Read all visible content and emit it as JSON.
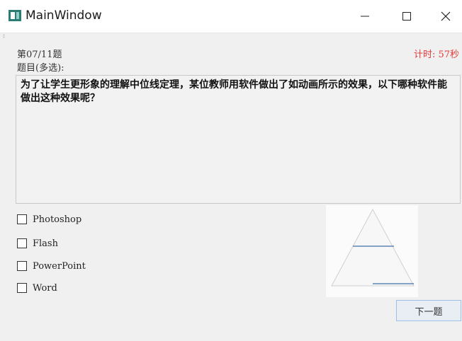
{
  "window": {
    "title": "MainWindow",
    "controls": {
      "minimize_icon": "minimize-icon",
      "maximize_icon": "maximize-icon",
      "close_icon": "close-icon"
    }
  },
  "quiz": {
    "question_number": "第07/11题",
    "timer": "计时: 57秒",
    "question_type": "题目(多选):",
    "question_text": "为了让学生更形象的理解中位线定理，某位教师用软件做出了如动画所示的效果，以下哪种软件能做出这种效果呢？",
    "options": [
      {
        "label": "Photoshop",
        "checked": false
      },
      {
        "label": "Flash",
        "checked": false
      },
      {
        "label": "PowerPoint",
        "checked": false
      },
      {
        "label": "Word",
        "checked": false
      }
    ],
    "next_button": "下一题"
  },
  "colors": {
    "timer": "#e23c3c",
    "midline": "#3f6fa8"
  }
}
